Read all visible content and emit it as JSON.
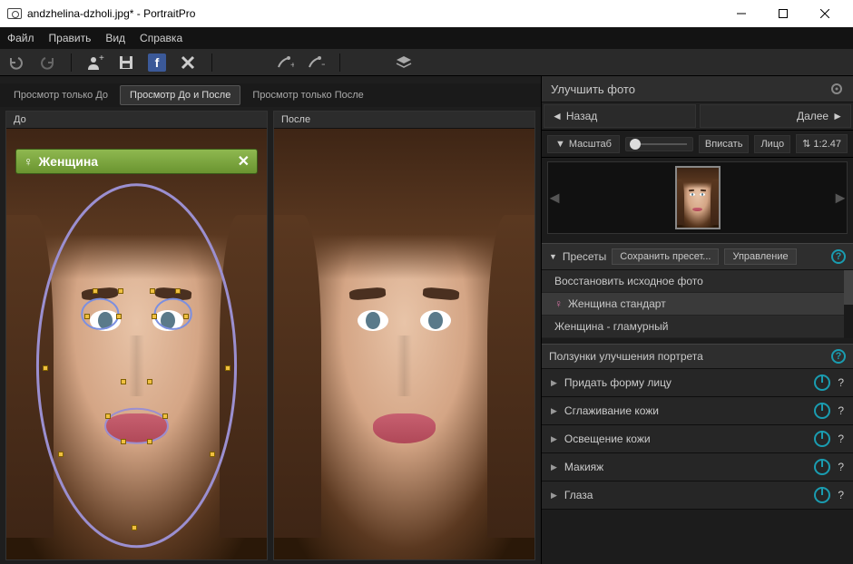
{
  "titlebar": {
    "filename": "andzhelina-dzholi.jpg*",
    "appname": "PortraitPro"
  },
  "menu": {
    "file": "Файл",
    "edit": "Править",
    "view": "Вид",
    "help": "Справка"
  },
  "tabs": {
    "before_only": "Просмотр только До",
    "before_after": "Просмотр До и После",
    "after_only": "Просмотр только После"
  },
  "labels": {
    "before": "До",
    "after": "После"
  },
  "gender_badge": {
    "symbol": "♀",
    "text": "Женщина"
  },
  "rightpanel": {
    "header": "Улучшить фото",
    "back": "Назад",
    "next": "Далее",
    "zoom_label": "Масштаб",
    "fit": "Вписать",
    "face": "Лицо",
    "ratio": "1:2.47",
    "presets_label": "Пресеты",
    "save_preset": "Сохранить пресет...",
    "manage": "Управление",
    "presets": {
      "restore": "Восстановить исходное фото",
      "female_std": "Женщина стандарт",
      "female_glam": "Женщина - гламурный"
    },
    "sliders_header": "Ползунки улучшения портрета",
    "sliders": {
      "face_shape": "Придать форму лицу",
      "skin_smooth": "Сглаживание кожи",
      "skin_light": "Освещение кожи",
      "makeup": "Макияж",
      "eyes": "Глаза"
    }
  }
}
